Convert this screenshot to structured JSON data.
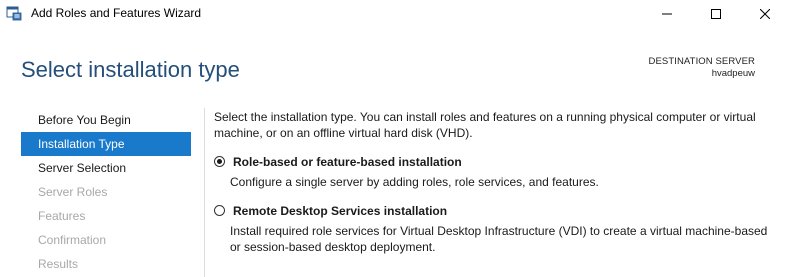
{
  "window": {
    "title": "Add Roles and Features Wizard",
    "icon": "server-manager-icon"
  },
  "header": {
    "page_title": "Select installation type",
    "destination_label": "DESTINATION SERVER",
    "destination_server": "hvadpeuw"
  },
  "sidebar": {
    "items": [
      {
        "label": "Before You Begin",
        "state": "enabled"
      },
      {
        "label": "Installation Type",
        "state": "selected"
      },
      {
        "label": "Server Selection",
        "state": "enabled"
      },
      {
        "label": "Server Roles",
        "state": "disabled"
      },
      {
        "label": "Features",
        "state": "disabled"
      },
      {
        "label": "Confirmation",
        "state": "disabled"
      },
      {
        "label": "Results",
        "state": "disabled"
      }
    ]
  },
  "content": {
    "intro": "Select the installation type. You can install roles and features on a running physical computer or virtual machine, or on an offline virtual hard disk (VHD).",
    "options": [
      {
        "title": "Role-based or feature-based installation",
        "description": "Configure a single server by adding roles, role services, and features.",
        "selected": true
      },
      {
        "title": "Remote Desktop Services installation",
        "description": "Install required role services for Virtual Desktop Infrastructure (VDI) to create a virtual machine-based or session-based desktop deployment.",
        "selected": false
      }
    ]
  },
  "colors": {
    "accent": "#1979ca",
    "title": "#244f7a",
    "disabled_text": "#a8a8a8"
  }
}
